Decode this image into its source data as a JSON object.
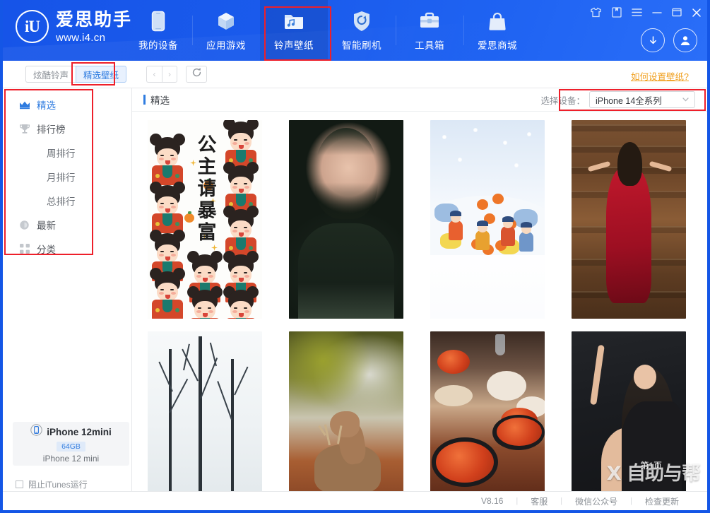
{
  "app": {
    "brand_name": "爱思助手",
    "brand_url": "www.i4.cn",
    "logo_mark": "iU",
    "accent_blue": "#1456e6",
    "link_orange": "#f0a020",
    "annotation_red": "#ee1f2a"
  },
  "header": {
    "nav": [
      {
        "label": "我的设备",
        "icon": "phone-icon",
        "active": false
      },
      {
        "label": "应用游戏",
        "icon": "cube-icon",
        "active": false
      },
      {
        "label": "铃声壁纸",
        "icon": "folder-music-icon",
        "active": true
      },
      {
        "label": "智能刷机",
        "icon": "shield-refresh-icon",
        "active": false
      },
      {
        "label": "工具箱",
        "icon": "toolbox-icon",
        "active": false
      },
      {
        "label": "爱思商城",
        "icon": "shopping-bag-icon",
        "active": false
      }
    ],
    "window_controls": [
      {
        "name": "shirt-icon"
      },
      {
        "name": "book-icon"
      },
      {
        "name": "menu-icon"
      },
      {
        "name": "minimize-icon"
      },
      {
        "name": "maximize-icon"
      },
      {
        "name": "close-icon"
      }
    ],
    "user_controls": [
      {
        "name": "download-icon"
      },
      {
        "name": "account-icon"
      }
    ]
  },
  "toolbar": {
    "segments": [
      {
        "label": "炫酷铃声",
        "active": false
      },
      {
        "label": "精选壁纸",
        "active": true
      }
    ],
    "back_label": "‹",
    "forward_label": "›",
    "refresh_label": "refresh-icon",
    "help_link": "如何设置壁纸?"
  },
  "sidebar": {
    "items": [
      {
        "label": "精选",
        "icon": "crown-icon",
        "active": true,
        "sub": false
      },
      {
        "label": "排行榜",
        "icon": "trophy-icon",
        "active": false,
        "sub": false
      },
      {
        "label": "周排行",
        "icon": "",
        "active": false,
        "sub": true
      },
      {
        "label": "月排行",
        "icon": "",
        "active": false,
        "sub": true
      },
      {
        "label": "总排行",
        "icon": "",
        "active": false,
        "sub": true
      },
      {
        "label": "最新",
        "icon": "clock-icon",
        "active": false,
        "sub": false
      },
      {
        "label": "分类",
        "icon": "grid-icon",
        "active": false,
        "sub": false
      }
    ],
    "device_card": {
      "name": "iPhone 12mini",
      "capacity": "64GB",
      "model": "iPhone 12 mini",
      "icon": "phone-circle-icon"
    },
    "itunes_checkbox": {
      "label": "阻止iTunes运行",
      "checked": false
    }
  },
  "content": {
    "section_title": "精选",
    "device_selector": {
      "label": "选择设备：",
      "value": "iPhone 14全系列",
      "caret": "chevron-down-icon"
    },
    "page_label": "第1页",
    "watermark": "X 自助与帮",
    "wallpapers": [
      {
        "id": 1,
        "art": "t-cartoon",
        "caption": "公主请暴富",
        "row": 1
      },
      {
        "id": 2,
        "art": "t-portrait1",
        "caption": "",
        "row": 1
      },
      {
        "id": 3,
        "art": "t-snow",
        "caption": "",
        "row": 1
      },
      {
        "id": 4,
        "art": "t-reddress",
        "caption": "",
        "row": 1
      },
      {
        "id": 5,
        "art": "t-trees",
        "caption": "",
        "row": 2
      },
      {
        "id": 6,
        "art": "t-deer",
        "caption": "",
        "row": 2
      },
      {
        "id": 7,
        "art": "t-food",
        "caption": "",
        "row": 2
      },
      {
        "id": 8,
        "art": "t-dark",
        "caption": "",
        "row": 2
      }
    ]
  },
  "statusbar": {
    "version": "V8.16",
    "items": [
      {
        "label": "客服"
      },
      {
        "label": "微信公众号"
      },
      {
        "label": "检查更新"
      }
    ],
    "separator": "|"
  }
}
